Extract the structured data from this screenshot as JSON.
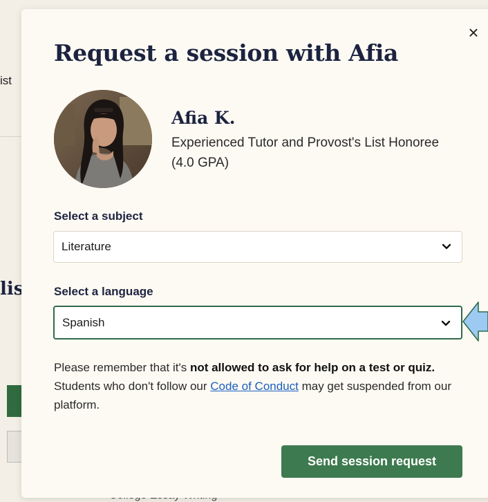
{
  "background": {
    "fragment_text": "ist",
    "fragment_heading": "lis",
    "bottom_text": "College Essay Writing"
  },
  "modal": {
    "title": "Request a session with Afia",
    "close_label": "×"
  },
  "tutor": {
    "name": "Afia K.",
    "description": "Experienced Tutor and Provost's List Honoree (4.0 GPA)"
  },
  "subject": {
    "label": "Select a subject",
    "value": "Literature"
  },
  "language": {
    "label": "Select a language",
    "value": "Spanish"
  },
  "notice": {
    "before": "Please remember that it's ",
    "bold": "not allowed to ask for help on a test or quiz.",
    "middle": " Students who don't follow our ",
    "link": "Code of Conduct",
    "after": " may get suspended from our platform."
  },
  "actions": {
    "send_label": "Send session request"
  },
  "colors": {
    "accent_green": "#3d7a4f",
    "focus_border": "#2f6b4a",
    "title_navy": "#1c2340",
    "link_blue": "#1c5fbf",
    "arrow_blue": "#9ccaf2"
  }
}
